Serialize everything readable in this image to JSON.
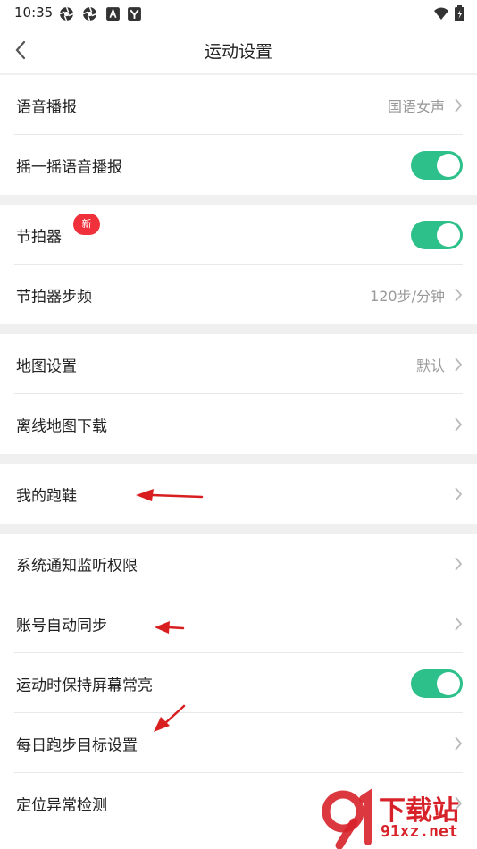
{
  "status_bar": {
    "time": "10:35",
    "icons": [
      "aperture-icon",
      "aperture-icon",
      "a-icon",
      "y-app-icon"
    ],
    "right_icons": [
      "wifi-icon",
      "battery-icon"
    ]
  },
  "header": {
    "title": "运动设置"
  },
  "groups": [
    {
      "rows": [
        {
          "label": "语音播报",
          "value": "国语女声",
          "control": "chevron"
        },
        {
          "label": "摇一摇语音播报",
          "control": "toggle",
          "on": true
        }
      ]
    },
    {
      "rows": [
        {
          "label": "节拍器",
          "badge": "新",
          "control": "toggle",
          "on": true
        },
        {
          "label": "节拍器步频",
          "value": "120步/分钟",
          "control": "chevron"
        }
      ]
    },
    {
      "rows": [
        {
          "label": "地图设置",
          "value": "默认",
          "control": "chevron"
        },
        {
          "label": "离线地图下载",
          "control": "chevron"
        }
      ]
    },
    {
      "rows": [
        {
          "label": "我的跑鞋",
          "control": "chevron"
        }
      ]
    },
    {
      "rows": [
        {
          "label": "系统通知监听权限",
          "control": "chevron"
        },
        {
          "label": "账号自动同步",
          "control": "chevron"
        },
        {
          "label": "运动时保持屏幕常亮",
          "control": "toggle",
          "on": true
        },
        {
          "label": "每日跑步目标设置",
          "control": "chevron"
        },
        {
          "label": "定位异常检测",
          "control": "chevron"
        }
      ]
    }
  ],
  "colors": {
    "toggle_on": "#2dc08a",
    "badge": "#f0303a",
    "annotation_arrow": "#d81e1e",
    "watermark": "#d8222a"
  },
  "watermark": {
    "text_main": "下载站",
    "text_sub": "91xz.net"
  }
}
